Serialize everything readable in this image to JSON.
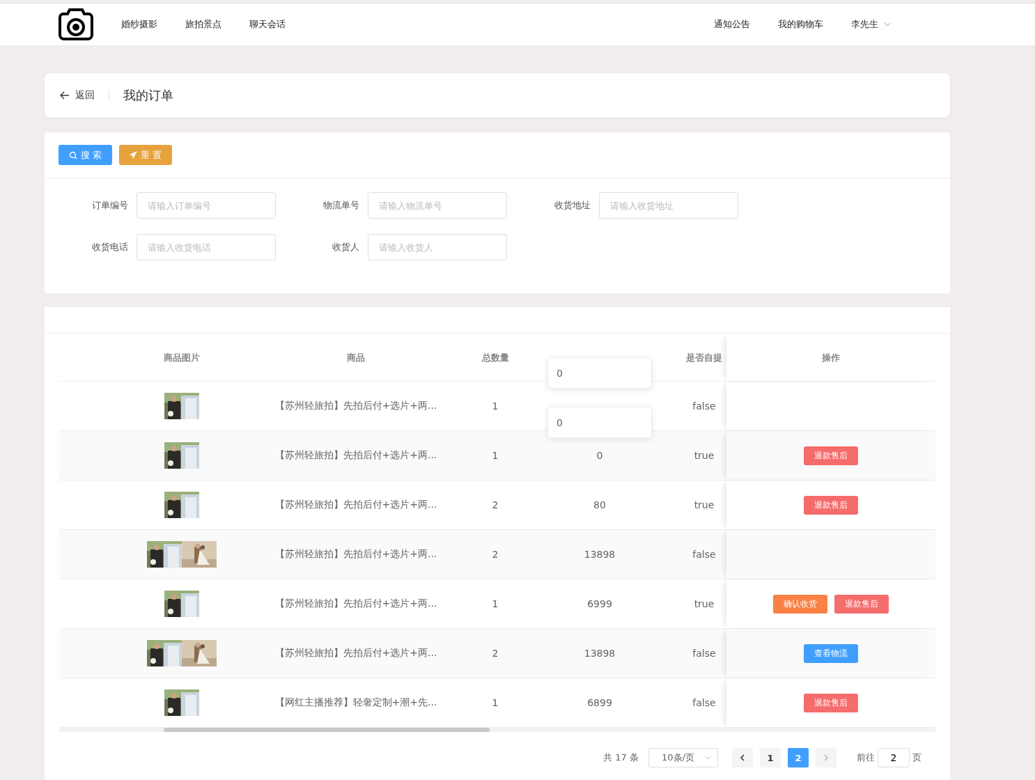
{
  "nav": {
    "links": [
      {
        "label": "婚纱摄影"
      },
      {
        "label": "旅拍景点"
      },
      {
        "label": "聊天会话"
      }
    ],
    "right": [
      {
        "label": "通知公告"
      },
      {
        "label": "我的购物车"
      }
    ],
    "user": "李先生"
  },
  "breadcrumb": {
    "back": "返回",
    "title": "我的订单"
  },
  "actions": [
    {
      "kind": "search",
      "label": "搜 索"
    },
    {
      "kind": "reset",
      "label": "重 置"
    }
  ],
  "filters": [
    {
      "label": "订单编号",
      "placeholder": "请输入订单编号"
    },
    {
      "label": "物流单号",
      "placeholder": "请输入物流单号"
    },
    {
      "label": "收货地址",
      "placeholder": "请输入收货地址"
    },
    {
      "label": "收货电话",
      "placeholder": "请输入收货电话"
    },
    {
      "label": "收货人",
      "placeholder": "请输入收货人"
    }
  ],
  "table": {
    "columns": [
      "商品图片",
      "商品",
      "总数量",
      "是否自提",
      "操作"
    ],
    "rows": [
      {
        "images": [
          {
            "kind": "picture"
          }
        ],
        "goods": "【苏州轻旅拍】先拍后付+选片+两...",
        "qty": "1",
        "pickup": "false",
        "buttons": []
      },
      {
        "images": [
          {
            "kind": "picture"
          }
        ],
        "goods": "【苏州轻旅拍】先拍后付+选片+两...",
        "qty": "1",
        "amount": "0",
        "pickup": "true",
        "buttons": [
          {
            "kind": "refund",
            "label": "退款售后"
          }
        ]
      },
      {
        "images": [
          {
            "kind": "picture"
          }
        ],
        "goods": "【苏州轻旅拍】先拍后付+选片+两...",
        "qty": "2",
        "amount": "80",
        "pickup": "true",
        "buttons": [
          {
            "kind": "refund",
            "label": "退款售后"
          }
        ]
      },
      {
        "images": [
          {
            "kind": "picture"
          },
          {
            "kind": "picture"
          }
        ],
        "goods": "【苏州轻旅拍】先拍后付+选片+两...",
        "qty": "2",
        "amount": "13898",
        "pickup": "false",
        "buttons": []
      },
      {
        "images": [
          {
            "kind": "picture"
          }
        ],
        "goods": "【苏州轻旅拍】先拍后付+选片+两...",
        "qty": "1",
        "amount": "6999",
        "pickup": "true",
        "buttons": [
          {
            "kind": "confirm",
            "label": "确认收货"
          },
          {
            "kind": "refund",
            "label": "退款售后"
          }
        ]
      },
      {
        "images": [
          {
            "kind": "picture"
          },
          {
            "kind": "picture"
          }
        ],
        "goods": "【苏州轻旅拍】先拍后付+选片+两...",
        "qty": "2",
        "amount": "13898",
        "pickup": "false",
        "buttons": [
          {
            "kind": "logistics",
            "label": "查看物流"
          }
        ]
      },
      {
        "images": [
          {
            "kind": "picture"
          }
        ],
        "goods": "【网红主播推荐】轻奢定制+潮+先...",
        "qty": "1",
        "amount": "6899",
        "pickup": "false",
        "buttons": [
          {
            "kind": "refund",
            "label": "退款售后"
          }
        ]
      }
    ],
    "tooltips": [
      "0",
      "0"
    ]
  },
  "pagination": {
    "total": "共 17 条",
    "size": "10条/页",
    "pages": [
      {
        "label": "1",
        "selected": false
      },
      {
        "label": "2",
        "selected": true
      }
    ],
    "goto": "前往",
    "current": "2",
    "unit": "页"
  }
}
